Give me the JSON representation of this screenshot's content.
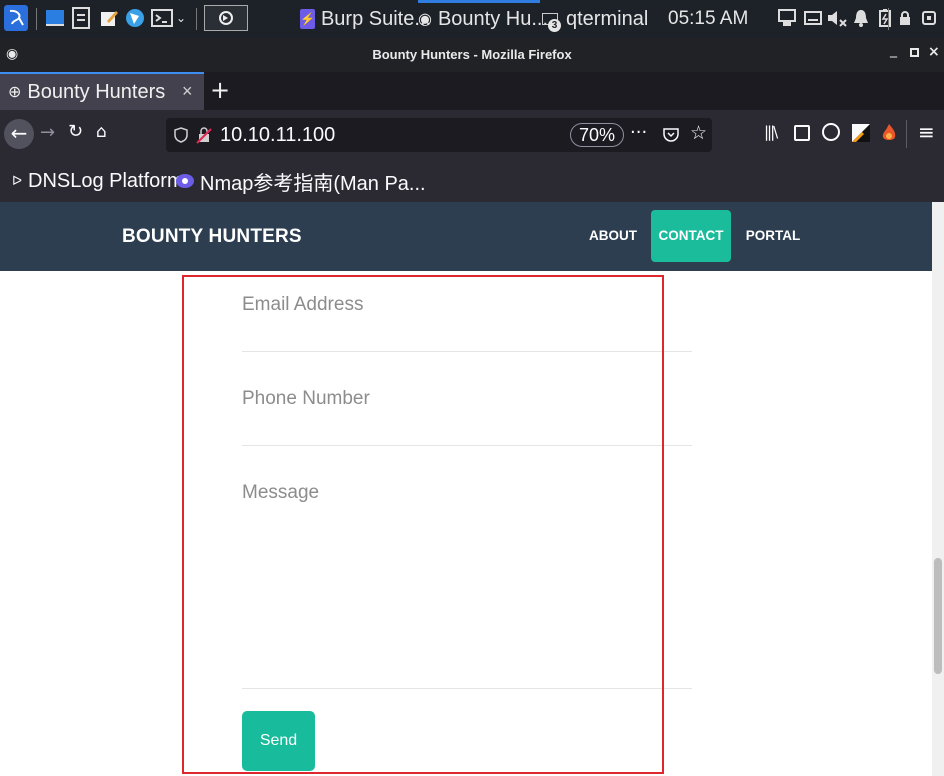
{
  "taskbar": {
    "tasks": [
      {
        "label": "Burp Suite..."
      },
      {
        "label": "Bounty Hu..."
      },
      {
        "label": "qterminal"
      }
    ],
    "clock": "05:15 AM",
    "terminal_badge": "3"
  },
  "window": {
    "title": "Bounty Hunters - Mozilla Firefox"
  },
  "browser": {
    "tab": {
      "title": "Bounty Hunters"
    },
    "url": "10.10.11.100",
    "zoom": "70%",
    "bookmarks": [
      {
        "label": "DNSLog Platform"
      },
      {
        "label": "Nmap参考指南(Man Pa..."
      }
    ]
  },
  "site": {
    "brand": "BOUNTY HUNTERS",
    "nav": [
      {
        "label": "ABOUT"
      },
      {
        "label": "CONTACT"
      },
      {
        "label": "PORTAL"
      }
    ],
    "form": {
      "email_placeholder": "Email Address",
      "phone_placeholder": "Phone Number",
      "message_placeholder": "Message",
      "send_label": "Send"
    }
  },
  "colors": {
    "site_nav_bg": "#2c3e50",
    "accent": "#1abc9c",
    "highlight_box": "#e0262d"
  }
}
